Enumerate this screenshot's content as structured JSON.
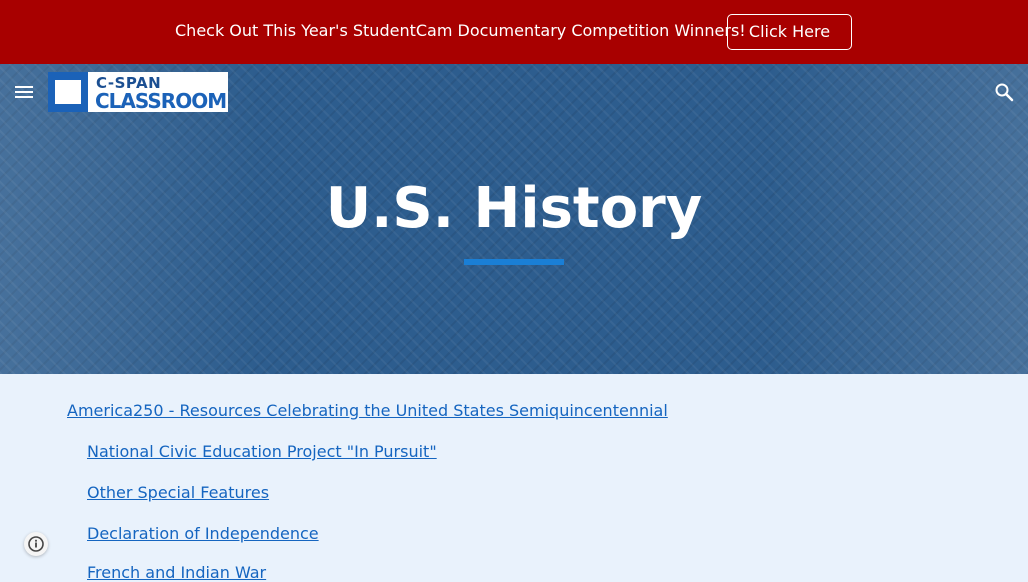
{
  "banner": {
    "text": "Check Out This Year's StudentCam Documentary Competition Winners!",
    "button_label": "Click Here"
  },
  "header": {
    "logo_top": "C-SPAN",
    "logo_bottom": "CLASSROOM",
    "menu_icon": "menu-icon",
    "search_icon": "search-icon"
  },
  "hero": {
    "title": "U.S. History"
  },
  "links": [
    "America250 - Resources Celebrating the United States Semiquincentennial",
    "National Civic Education Project \"In Pursuit\"",
    "Other Special Features",
    "Declaration of Independence",
    "French and Indian War"
  ],
  "footer": {
    "info_icon": "info-icon"
  },
  "colors": {
    "banner": "#a80000",
    "hero": "#2d5d8e",
    "accent": "#1a7fd6",
    "link": "#1565c0",
    "page_bg": "#e9f2fc"
  }
}
